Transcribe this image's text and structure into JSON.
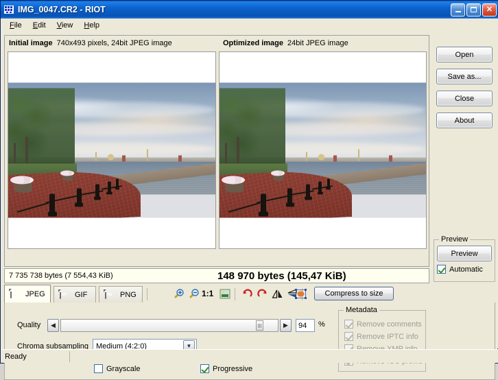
{
  "window": {
    "title": "IMG_0047.CR2 - RIOT",
    "icon": "riot-app-icon",
    "buttons": {
      "minimize": "minimize-button",
      "maximize": "maximize-button",
      "close": "close-button"
    }
  },
  "menu": {
    "items": [
      {
        "label": "File",
        "mnemonic": "F"
      },
      {
        "label": "Edit",
        "mnemonic": "E"
      },
      {
        "label": "View",
        "mnemonic": "V"
      },
      {
        "label": "Help",
        "mnemonic": "H"
      }
    ]
  },
  "panels": {
    "initial": {
      "title": "Initial image",
      "info": "740x493 pixels, 24bit JPEG image",
      "size": "7 735 738 bytes (7 554,43 KiB)"
    },
    "optimized": {
      "title": "Optimized image",
      "info": "24bit JPEG image",
      "size": "148 970 bytes (145,47 KiB)"
    }
  },
  "photo": {
    "description": "Neva river embankment, Saint Petersburg: red brick promenade with black bollards and chains, cobblestone shore, trees at left, city skyline across the water under a cloudy sky"
  },
  "actions": {
    "open": "Open",
    "save_as": "Save as...",
    "close": "Close",
    "about": "About"
  },
  "preview": {
    "group_title": "Preview",
    "button": "Preview",
    "automatic_label": "Automatic",
    "automatic_checked": true
  },
  "tabs": [
    {
      "label": "JPEG",
      "icon": "jpeg-file-icon",
      "badge": "JPG",
      "active": true
    },
    {
      "label": "GIF",
      "icon": "gif-file-icon",
      "badge": "GIF",
      "active": false
    },
    {
      "label": "PNG",
      "icon": "png-file-icon",
      "badge": "PNG",
      "active": false
    }
  ],
  "toolbar": {
    "zoom_in": "zoom-in-icon",
    "zoom_out": "zoom-out-icon",
    "ratio": "1:1",
    "fit_to_window": "fit-to-window-icon",
    "rotate_left": "rotate-left-icon",
    "rotate_right": "rotate-right-icon",
    "flip_horizontal": "flip-horizontal-icon",
    "flip_vertical": "flip-vertical-icon",
    "resize": "resize-icon",
    "compress_to_size": "Compress to size"
  },
  "jpeg_options": {
    "quality_label": "Quality",
    "quality_value": "94",
    "percent": "%",
    "quality_min": 0,
    "quality_max": 100,
    "chroma_label": "Chroma subsampling",
    "chroma_value": "Medium (4:2:0)",
    "grayscale_label": "Grayscale",
    "grayscale_checked": false,
    "progressive_label": "Progressive",
    "progressive_checked": true
  },
  "metadata": {
    "group_title": "Metadata",
    "items": [
      {
        "label": "Remove comments",
        "checked": true,
        "disabled": true
      },
      {
        "label": "Remove IPTC info",
        "checked": true,
        "disabled": true
      },
      {
        "label": "Remove XMP info",
        "checked": true,
        "disabled": true
      },
      {
        "label": "Remove ICC profile",
        "checked": true,
        "disabled": true
      }
    ]
  },
  "statusbar": {
    "message": "Ready",
    "secondary": ""
  },
  "colors": {
    "title_blue": "#0c62cd",
    "face": "#ece9d8",
    "size_bar_bg": "#fffff0",
    "check_green": "#2a9028",
    "brick_red": "#8a3c31"
  }
}
